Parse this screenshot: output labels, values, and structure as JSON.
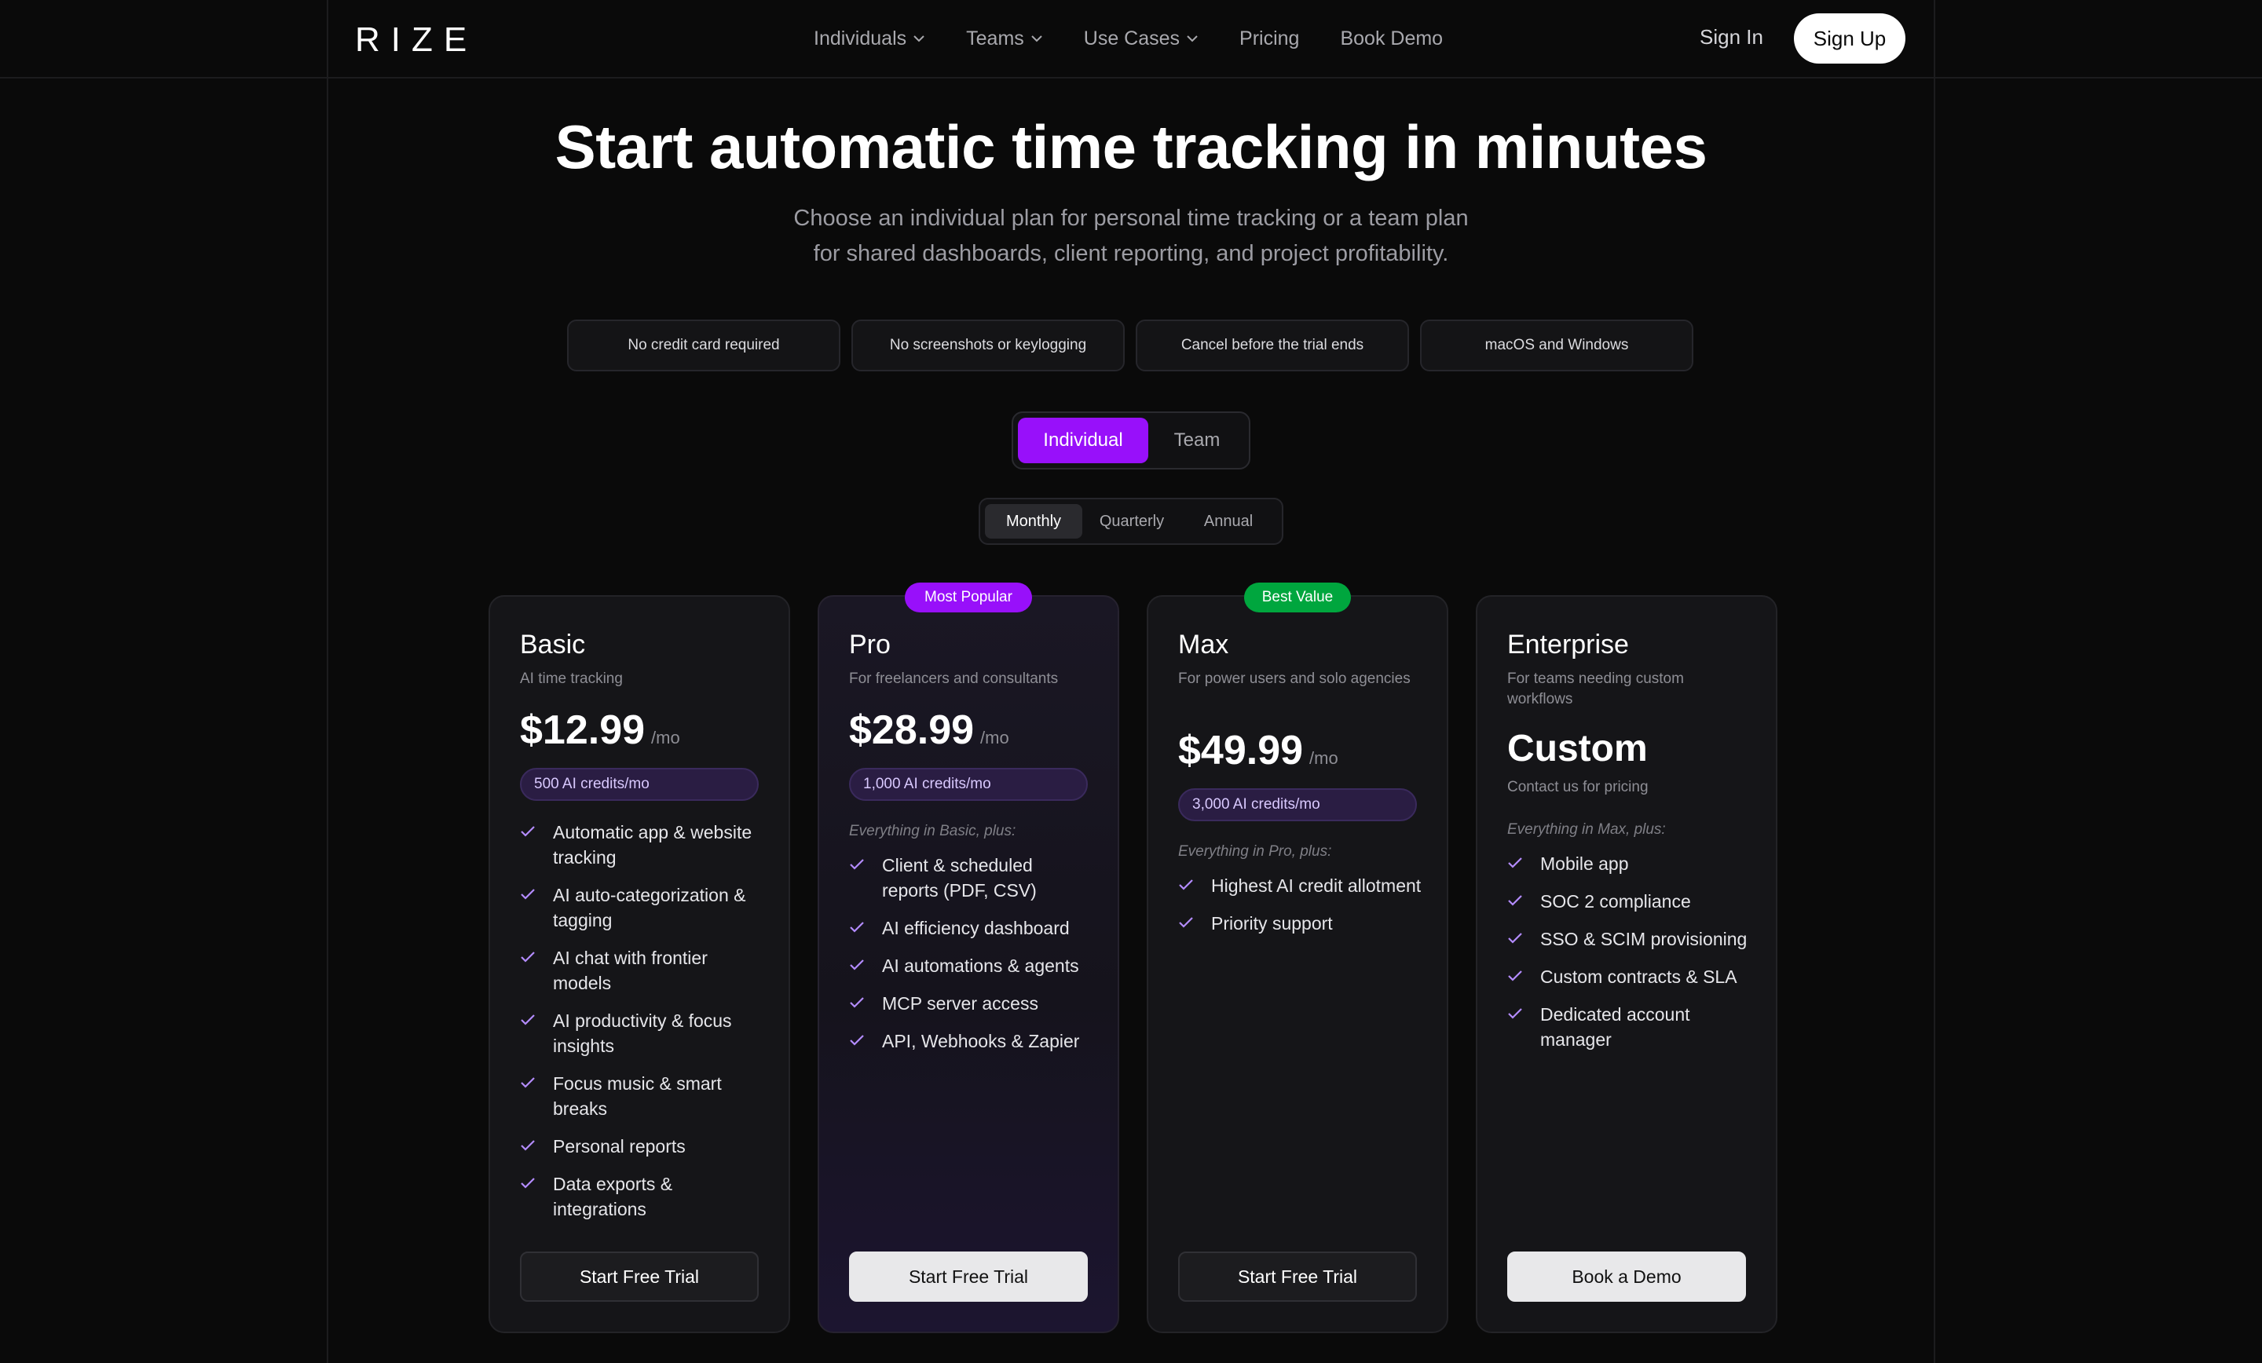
{
  "nav": {
    "logo": "RIZE",
    "links": [
      {
        "label": "Individuals",
        "dropdown": true
      },
      {
        "label": "Teams",
        "dropdown": true
      },
      {
        "label": "Use Cases",
        "dropdown": true
      },
      {
        "label": "Pricing",
        "dropdown": false
      },
      {
        "label": "Book Demo",
        "dropdown": false
      }
    ],
    "sign_in": "Sign In",
    "sign_up": "Sign Up"
  },
  "hero": {
    "title": "Start automatic time tracking in minutes",
    "subtitle_line1": "Choose an individual plan for personal time tracking or a team plan",
    "subtitle_line2": "for shared dashboards, client reporting, and project profitability."
  },
  "pills": [
    "No credit card required",
    "No screenshots or keylogging",
    "Cancel before the trial ends",
    "macOS and Windows"
  ],
  "plan_toggle": {
    "options": [
      "Individual",
      "Team"
    ],
    "selected": "Individual"
  },
  "billing_toggle": {
    "options": [
      "Monthly",
      "Quarterly",
      "Annual"
    ],
    "selected": "Monthly"
  },
  "colors": {
    "accent": "#9810fa",
    "best_value": "#00a63e",
    "check": "#b48cff"
  },
  "plans": [
    {
      "name": "Basic",
      "description": "AI time tracking",
      "price": "$12.99",
      "period": "/mo",
      "credits": "500 AI credits/mo",
      "features": [
        "Automatic app & website tracking",
        "AI auto-categorization & tagging",
        "AI chat with frontier models",
        "AI productivity & focus insights",
        "Focus music & smart breaks",
        "Personal reports",
        "Data exports & integrations"
      ],
      "cta": "Start Free Trial"
    },
    {
      "name": "Pro",
      "badge": "Most Popular",
      "description": "For freelancers and consultants",
      "price": "$28.99",
      "period": "/mo",
      "credits": "1,000 AI credits/mo",
      "includes": "Everything in Basic, plus:",
      "features": [
        "Client & scheduled reports (PDF, CSV)",
        "AI efficiency dashboard",
        "AI automations & agents",
        "MCP server access",
        "API, Webhooks & Zapier"
      ],
      "cta": "Start Free Trial"
    },
    {
      "name": "Max",
      "badge": "Best Value",
      "description": "For power users and solo agencies",
      "price": "$49.99",
      "period": "/mo",
      "credits": "3,000 AI credits/mo",
      "includes": "Everything in Pro, plus:",
      "features": [
        "Highest AI credit allotment",
        "Priority support"
      ],
      "cta": "Start Free Trial"
    },
    {
      "name": "Enterprise",
      "description": "For teams needing custom workflows",
      "price": "Custom",
      "contact": "Contact us for pricing",
      "includes": "Everything in Max, plus:",
      "features": [
        "Mobile app",
        "SOC 2 compliance",
        "SSO & SCIM provisioning",
        "Custom contracts & SLA",
        "Dedicated account manager"
      ],
      "cta": "Book a Demo"
    }
  ]
}
